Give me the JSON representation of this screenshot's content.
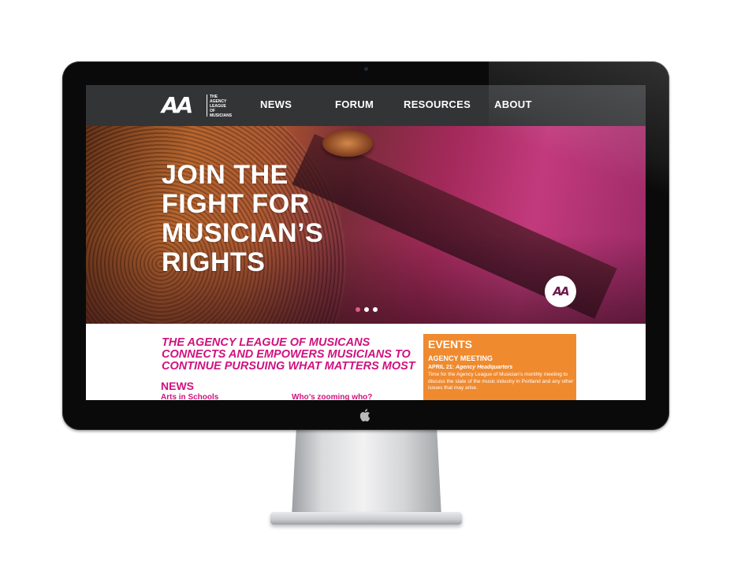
{
  "site": {
    "logo": {
      "mark": "AA",
      "lines": [
        "THE",
        "AGENCY",
        "LEAGUE",
        "OF",
        "MUSICIANS"
      ]
    },
    "nav": {
      "items": [
        {
          "label": "NEWS"
        },
        {
          "label": "FORUM"
        },
        {
          "label": "RESOURCES"
        },
        {
          "label": "ABOUT"
        }
      ]
    },
    "hero": {
      "title_lines": [
        "JOIN THE",
        "FIGHT FOR",
        "MUSICIAN’S",
        "RIGHTS"
      ],
      "badge": "AA",
      "slides": 3,
      "active_slide": 1
    },
    "tagline_lines": [
      "THE AGENCY LEAGUE OF MUSICANS",
      "CONNECTS AND EMPOWERS MUSICIANS TO",
      "CONTINUE PURSUING WHAT MATTERS MOST"
    ],
    "news": {
      "heading": "NEWS",
      "items": [
        {
          "title": "Arts in Schools"
        },
        {
          "title": "Who’s zooming who?"
        }
      ]
    },
    "events": {
      "heading": "EVENTS",
      "name": "AGENCY MEETING",
      "date": "APRIL 21:",
      "location": "Agency Headquarters",
      "description": "Time for the Agency League of Musician’s monthly meeting to discuss the state of the music industry  in Portland and any other issues that may arise."
    }
  },
  "colors": {
    "nav_bg": "#333436",
    "accent_pink": "#d0127e",
    "events_orange": "#ef8a2f",
    "active_dot": "#e05a8c"
  },
  "icons": [
    "apple-logo-icon",
    "camera-icon"
  ]
}
